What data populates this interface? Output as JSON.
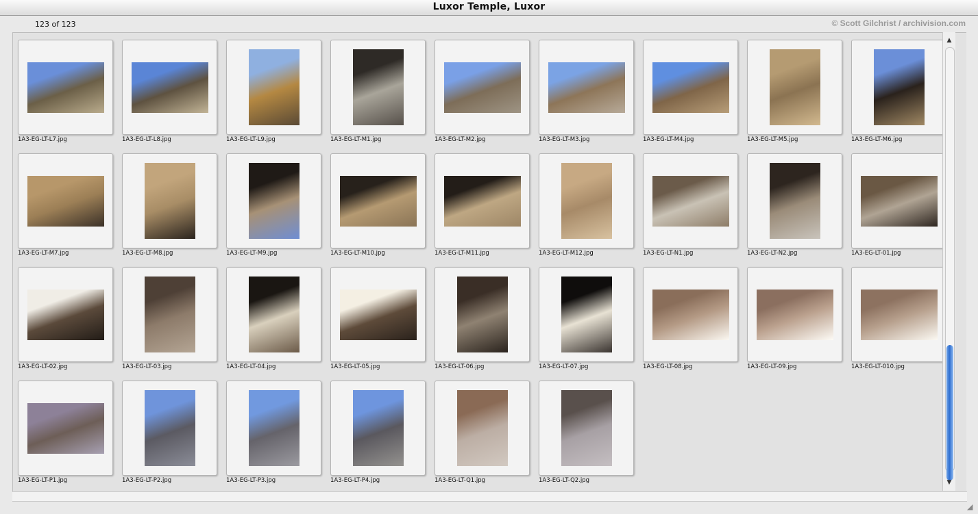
{
  "window": {
    "title": "Luxor Temple, Luxor"
  },
  "header": {
    "count_text": "123 of 123",
    "credit": "© Scott Gilchrist / archivision.com"
  },
  "thumbnails": [
    {
      "filename": "1A3-EG-LT-L7.jpg",
      "orientation": "landscape",
      "colors": [
        "#6a8fd9",
        "#6b5f47",
        "#b9ab8c"
      ]
    },
    {
      "filename": "1A3-EG-LT-L8.jpg",
      "orientation": "landscape",
      "colors": [
        "#5a85d6",
        "#5e5240",
        "#c2b496"
      ]
    },
    {
      "filename": "1A3-EG-LT-L9.jpg",
      "orientation": "portrait",
      "colors": [
        "#8fb0e0",
        "#b48842",
        "#5a4a35"
      ]
    },
    {
      "filename": "1A3-EG-LT-M1.jpg",
      "orientation": "portrait",
      "colors": [
        "#2e2a26",
        "#a9a59a",
        "#56504a"
      ]
    },
    {
      "filename": "1A3-EG-LT-M2.jpg",
      "orientation": "landscape",
      "colors": [
        "#7aa0e6",
        "#7d6d58",
        "#9e9484"
      ]
    },
    {
      "filename": "1A3-EG-LT-M3.jpg",
      "orientation": "landscape",
      "colors": [
        "#7ba3e4",
        "#8d7558",
        "#b7aa99"
      ]
    },
    {
      "filename": "1A3-EG-LT-M4.jpg",
      "orientation": "landscape",
      "colors": [
        "#5f8fe0",
        "#7f6548",
        "#b79d78"
      ]
    },
    {
      "filename": "1A3-EG-LT-M5.jpg",
      "orientation": "portrait",
      "colors": [
        "#b59b72",
        "#8b7352",
        "#d2b98f"
      ]
    },
    {
      "filename": "1A3-EG-LT-M6.jpg",
      "orientation": "portrait",
      "colors": [
        "#6b8fd8",
        "#2a221c",
        "#a08863"
      ]
    },
    {
      "filename": "1A3-EG-LT-M7.jpg",
      "orientation": "landscape",
      "colors": [
        "#b7976a",
        "#9c7f56",
        "#3b3128"
      ]
    },
    {
      "filename": "1A3-EG-LT-M8.jpg",
      "orientation": "portrait",
      "colors": [
        "#c2a57c",
        "#a88d66",
        "#2b241e"
      ]
    },
    {
      "filename": "1A3-EG-LT-M9.jpg",
      "orientation": "portrait",
      "colors": [
        "#1f1a16",
        "#a79176",
        "#6f8ed3"
      ]
    },
    {
      "filename": "1A3-EG-LT-M10.jpg",
      "orientation": "landscape",
      "colors": [
        "#27211b",
        "#b59a72",
        "#8a7456"
      ]
    },
    {
      "filename": "1A3-EG-LT-M11.jpg",
      "orientation": "landscape",
      "colors": [
        "#231d18",
        "#bea783",
        "#9d8666"
      ]
    },
    {
      "filename": "1A3-EG-LT-M12.jpg",
      "orientation": "portrait",
      "colors": [
        "#c7a983",
        "#a78a68",
        "#d8c2a0"
      ]
    },
    {
      "filename": "1A3-EG-LT-N1.jpg",
      "orientation": "landscape",
      "colors": [
        "#6b5b4a",
        "#c9c2b5",
        "#8d7c67"
      ]
    },
    {
      "filename": "1A3-EG-LT-N2.jpg",
      "orientation": "portrait",
      "colors": [
        "#2d251f",
        "#9a8b78",
        "#c9c4bc"
      ]
    },
    {
      "filename": "1A3-EG-LT-01.jpg",
      "orientation": "landscape",
      "colors": [
        "#6a5844",
        "#b0a494",
        "#2e2620"
      ]
    },
    {
      "filename": "1A3-EG-LT-02.jpg",
      "orientation": "landscape",
      "colors": [
        "#f0ede6",
        "#5b4a3b",
        "#221c17"
      ]
    },
    {
      "filename": "1A3-EG-LT-03.jpg",
      "orientation": "portrait",
      "colors": [
        "#4e4036",
        "#8d7b6a",
        "#b4a594"
      ]
    },
    {
      "filename": "1A3-EG-LT-04.jpg",
      "orientation": "portrait",
      "colors": [
        "#1a1612",
        "#d9d0bd",
        "#6b5a48"
      ]
    },
    {
      "filename": "1A3-EG-LT-05.jpg",
      "orientation": "landscape",
      "colors": [
        "#f4efe3",
        "#5e4b3a",
        "#2a221c"
      ]
    },
    {
      "filename": "1A3-EG-LT-06.jpg",
      "orientation": "portrait",
      "colors": [
        "#3a2e26",
        "#8f8272",
        "#2a231d"
      ]
    },
    {
      "filename": "1A3-EG-LT-07.jpg",
      "orientation": "portrait",
      "colors": [
        "#0f0d0c",
        "#e8e2d4",
        "#3a3430"
      ]
    },
    {
      "filename": "1A3-EG-LT-08.jpg",
      "orientation": "landscape",
      "colors": [
        "#8a6e5a",
        "#b49a85",
        "#fbf8f2"
      ]
    },
    {
      "filename": "1A3-EG-LT-09.jpg",
      "orientation": "landscape",
      "colors": [
        "#8b6f5f",
        "#bba18e",
        "#fdfbf6"
      ]
    },
    {
      "filename": "1A3-EG-LT-010.jpg",
      "orientation": "landscape",
      "colors": [
        "#8d7260",
        "#b7a08d",
        "#fbf9f3"
      ]
    },
    {
      "filename": "1A3-EG-LT-P1.jpg",
      "orientation": "landscape",
      "colors": [
        "#8d8198",
        "#6d5e57",
        "#a7a0b2"
      ]
    },
    {
      "filename": "1A3-EG-LT-P2.jpg",
      "orientation": "portrait",
      "colors": [
        "#6f94db",
        "#5b5a62",
        "#8b8d98"
      ]
    },
    {
      "filename": "1A3-EG-LT-P3.jpg",
      "orientation": "portrait",
      "colors": [
        "#7199df",
        "#65636a",
        "#9b9aa0"
      ]
    },
    {
      "filename": "1A3-EG-LT-P4.jpg",
      "orientation": "portrait",
      "colors": [
        "#6e95de",
        "#5a585e",
        "#94928f"
      ]
    },
    {
      "filename": "1A3-EG-LT-Q1.jpg",
      "orientation": "portrait",
      "colors": [
        "#8a6a55",
        "#bcaea4",
        "#d2c9c1"
      ]
    },
    {
      "filename": "1A3-EG-LT-Q2.jpg",
      "orientation": "portrait",
      "colors": [
        "#59504c",
        "#a7a0a4",
        "#c5bfc2"
      ]
    }
  ],
  "icons": {
    "scroll_up": "▲",
    "scroll_down": "▼",
    "resize_grip": "◢"
  }
}
